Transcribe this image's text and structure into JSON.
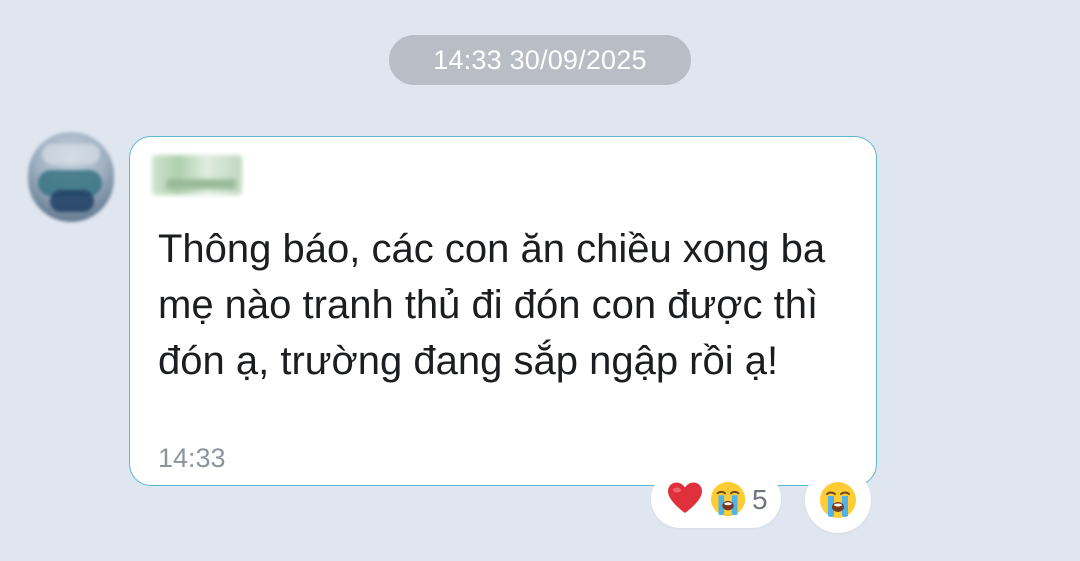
{
  "chat": {
    "date_separator": "14:33 30/09/2025",
    "message": {
      "text": "Thông báo, các con ăn chiều xong ba mẹ nào tranh thủ đi đón con được thì đón ạ, trường đang sắp ngập rồi ạ!",
      "time": "14:33"
    },
    "reactions": {
      "icons": [
        "heart-icon",
        "crying-face-icon"
      ],
      "count": "5"
    },
    "react_button_icon": "crying-face-icon"
  },
  "colors": {
    "background": "#e0e6ef",
    "bubble_border": "#5bb8cf",
    "date_pill": "#b8bdc6",
    "heart": "#e0303c"
  }
}
